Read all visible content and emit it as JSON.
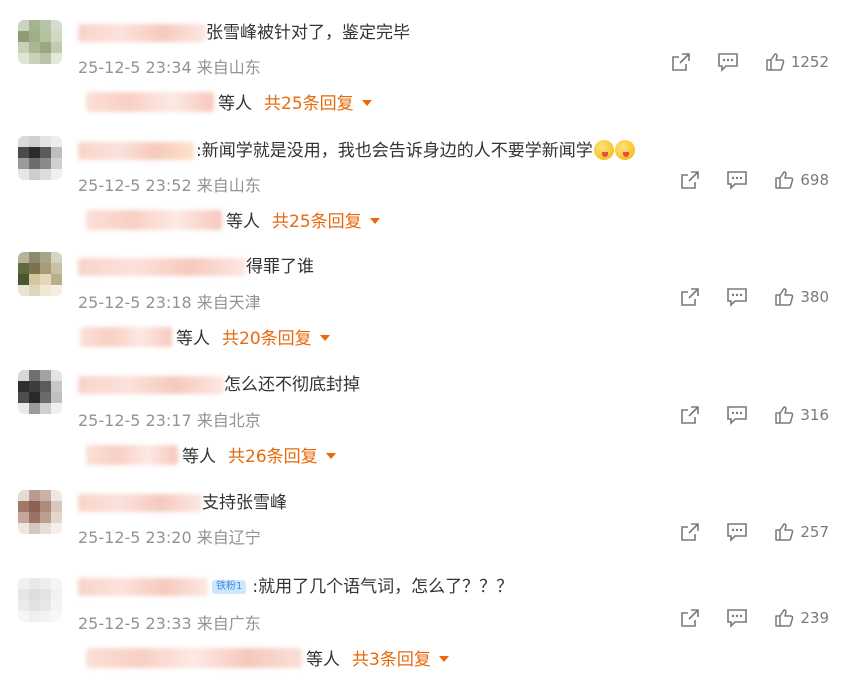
{
  "comments": [
    {
      "text": "张雪峰被针对了，鉴定完毕",
      "meta": "25-12-5 23:34 来自山东",
      "likes": "1252",
      "reply_suffix": "等人",
      "reply_count": "共25条回复"
    },
    {
      "text": ":新闻学就是没用，我也会告诉身边的人不要学新闻学",
      "meta": "25-12-5 23:52 来自山东",
      "likes": "698",
      "reply_suffix": "等人",
      "reply_count": "共25条回复"
    },
    {
      "text": "得罪了谁",
      "meta": "25-12-5 23:18 来自天津",
      "likes": "380",
      "reply_suffix": "等人",
      "reply_count": "共20条回复"
    },
    {
      "text": "怎么还不彻底封掉",
      "meta": "25-12-5 23:17 来自北京",
      "likes": "316",
      "reply_suffix": "等人",
      "reply_count": "共26条回复"
    },
    {
      "text": "支持张雪峰",
      "meta": "25-12-5 23:20 来自辽宁",
      "likes": "257"
    },
    {
      "badge": "铁粉1",
      "text": ":就用了几个语气词，怎么了？？？",
      "meta": "25-12-5 23:33 来自广东",
      "likes": "239",
      "reply_suffix": "等人",
      "reply_count": "共3条回复"
    }
  ],
  "icons": {
    "share": "share-icon",
    "comment": "comment-icon",
    "like": "thumbs-up-icon",
    "expand": "caret-down-icon",
    "emoji": "tongue-emoji-icon"
  },
  "colors": {
    "accent": "#e8690c",
    "meta": "#939393",
    "text": "#333333",
    "badge_bg": "#cfe6ff"
  }
}
